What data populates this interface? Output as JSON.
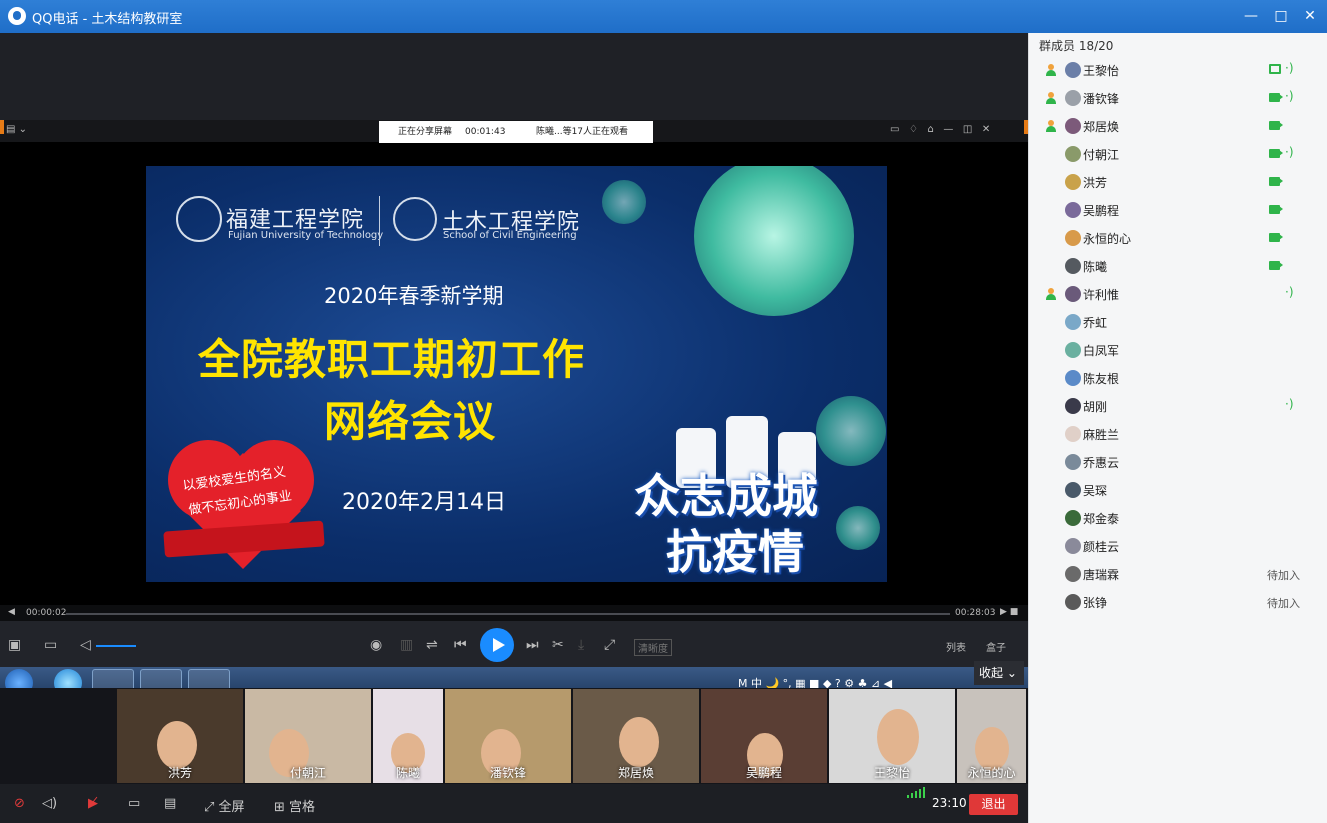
{
  "window": {
    "title": "QQ电话 - 土木结构教研室",
    "minimize": "—",
    "maximize": "□",
    "close": "✕"
  },
  "share_bar": {
    "status": "正在分享屏幕",
    "timer": "00:01:43",
    "viewers": "陈曦...等17人正在观看"
  },
  "slide": {
    "school_cn": "福建工程学院",
    "school_en": "Fujian University of Technology",
    "college_cn": "土木工程学院",
    "college_en": "School of Civil Engineering",
    "subtitle": "2020年春季新学期",
    "title_line1": "全院教职工期初工作",
    "title_line2": "网络会议",
    "heart_line1": "以爱校爱生的名义",
    "heart_line2": "做不忘初心的事业",
    "date": "2020年2月14日",
    "slogan_line1": "众志成城",
    "slogan_line2": "抗疫情"
  },
  "player": {
    "elapsed": "00:00:02",
    "duration": "00:28:03",
    "quality_label": "清晰度",
    "playlist_label": "列表",
    "box_label": "盒子"
  },
  "collapse_label": "收起",
  "taskbar": {
    "tray": "M 中 🌙 °, ▦ ■ ◆ ? ⚙ ♣ ⊿ ◀"
  },
  "thumbnails": [
    {
      "name": "洪芳",
      "bg": "#4a3a2c"
    },
    {
      "name": "付朝江",
      "bg": "#c9b9a4"
    },
    {
      "name": "陈曦",
      "bg": "#e7dfe6"
    },
    {
      "name": "潘钦锋",
      "bg": "#b69a6c"
    },
    {
      "name": "郑居焕",
      "bg": "#6a5a48"
    },
    {
      "name": "吴鹏程",
      "bg": "#5a3e34"
    },
    {
      "name": "王黎怡",
      "bg": "#d8d8d8"
    },
    {
      "name": "永恒的心",
      "bg": "#c8c2bc"
    }
  ],
  "bottom": {
    "fullscreen_label": "全屏",
    "grid_label": "宫格",
    "time": "23:10",
    "exit_label": "退出"
  },
  "members_header": "群成员 18/20",
  "members": [
    {
      "name": "王黎怡",
      "host": true,
      "video": "screen",
      "mic": true,
      "status": ""
    },
    {
      "name": "潘钦锋",
      "host": true,
      "video": "cam",
      "mic": true,
      "status": ""
    },
    {
      "name": "郑居焕",
      "host": true,
      "video": "cam",
      "mic": false,
      "status": ""
    },
    {
      "name": "付朝江",
      "host": false,
      "video": "cam",
      "mic": true,
      "status": ""
    },
    {
      "name": "洪芳",
      "host": false,
      "video": "cam",
      "mic": false,
      "status": ""
    },
    {
      "name": "吴鹏程",
      "host": false,
      "video": "cam",
      "mic": false,
      "status": ""
    },
    {
      "name": "永恒的心",
      "host": false,
      "video": "cam",
      "mic": false,
      "status": ""
    },
    {
      "name": "陈曦",
      "host": false,
      "video": "cam",
      "mic": false,
      "status": ""
    },
    {
      "name": "许利惟",
      "host": true,
      "video": "none",
      "mic": true,
      "status": ""
    },
    {
      "name": "乔虹",
      "host": false,
      "video": "none",
      "mic": false,
      "status": ""
    },
    {
      "name": "白凤军",
      "host": false,
      "video": "none",
      "mic": false,
      "status": ""
    },
    {
      "name": "陈友根",
      "host": false,
      "video": "none",
      "mic": false,
      "status": ""
    },
    {
      "name": "胡刚",
      "host": false,
      "video": "none",
      "mic": true,
      "status": ""
    },
    {
      "name": "麻胜兰",
      "host": false,
      "video": "none",
      "mic": false,
      "status": ""
    },
    {
      "name": "乔惠云",
      "host": false,
      "video": "none",
      "mic": false,
      "status": ""
    },
    {
      "name": "吴琛",
      "host": false,
      "video": "none",
      "mic": false,
      "status": ""
    },
    {
      "name": "郑金泰",
      "host": false,
      "video": "none",
      "mic": false,
      "status": ""
    },
    {
      "name": "颜桂云",
      "host": false,
      "video": "none",
      "mic": false,
      "status": ""
    },
    {
      "name": "唐瑞霖",
      "host": false,
      "video": "none",
      "mic": false,
      "status": "待加入"
    },
    {
      "name": "张铮",
      "host": false,
      "video": "none",
      "mic": false,
      "status": "待加入"
    }
  ],
  "colors": {
    "accent": "#1a8cff",
    "online": "#2fb44a",
    "exit": "#e03838",
    "slogan_yellow": "#ffe400"
  }
}
